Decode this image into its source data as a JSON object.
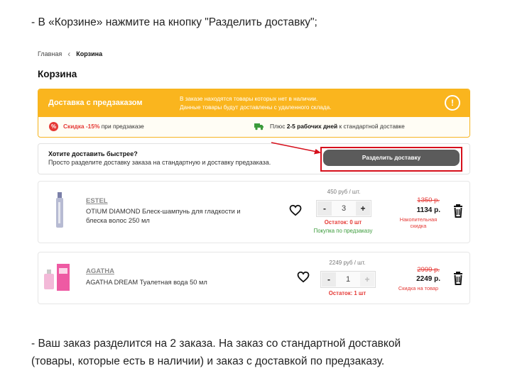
{
  "doc": {
    "line1": "-  В «Корзине» нажмите на кнопку \"Разделить доставку\";",
    "line2": "-  Ваш заказ разделится на 2 заказа. На заказ со стандартной доставкой",
    "line3": "(товары, которые есть в наличии) и заказ с доставкой по предзаказу."
  },
  "breadcrumb": {
    "home": "Главная",
    "current": "Корзина"
  },
  "page_title": "Корзина",
  "notice": {
    "title": "Доставка с предзаказом",
    "text1": "В заказе находятся товары которых нет в наличии.",
    "text2": "Данные товары будут доставлены с удаленного склада.",
    "info_glyph": "!",
    "discount_icon": "%",
    "discount_bold": "Скидка -15%",
    "discount_rest": " при предзаказе",
    "delivery_pre": "Плюс ",
    "delivery_bold": "2-5 рабочих дней",
    "delivery_post": " к стандартной доставке"
  },
  "split": {
    "question": "Хотите доставить быстрее?",
    "subtitle": "Просто разделите доставку заказа на стандартную и доставку предзаказа.",
    "button": "Разделить доставку"
  },
  "items": [
    {
      "brand": "ESTEL",
      "name": "OTIUM DIAMOND Блеск-шампунь для гладкости и блеска волос 250 мл",
      "unit_price": "450 руб / шт.",
      "minus": "-",
      "qty": "3",
      "plus": "+",
      "stock": "Остаток: 0 шт",
      "preorder": "Покупка по предзаказу",
      "old_price": "1350 р.",
      "new_price": "1134 р.",
      "note": "Накопительная скидка"
    },
    {
      "brand": "AGATHA",
      "name": "AGATHA DREAM Туалетная вода 50 мл",
      "unit_price": "2249 руб / шт.",
      "minus": "-",
      "qty": "1",
      "plus": "+",
      "stock": "Остаток: 1 шт",
      "old_price": "2999 р.",
      "new_price": "2249 р.",
      "note": "Скидка на товар"
    }
  ],
  "colors": {
    "accent": "#fab51e",
    "highlight": "#d6101c",
    "button": "#5b5b5b"
  },
  "icons": [
    "chevron-left-icon",
    "info-icon",
    "percent-icon",
    "truck-icon",
    "arrow-icon",
    "heart-icon",
    "trash-icon"
  ]
}
